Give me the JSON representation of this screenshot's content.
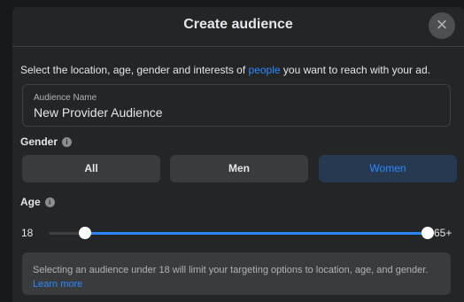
{
  "dialog": {
    "title": "Create audience",
    "close_icon": "close-icon",
    "close_glyph": "×"
  },
  "intro": {
    "text_before": "Select the location, age, gender and interests of ",
    "link": "people",
    "text_after": " you want to reach with your ad."
  },
  "audience_name": {
    "label": "Audience Name",
    "value": "New Provider Audience"
  },
  "gender": {
    "label": "Gender",
    "info_icon": "info-icon",
    "options": [
      "All",
      "Men",
      "Women"
    ],
    "selected": "Women"
  },
  "age": {
    "label": "Age",
    "info_icon": "info-icon",
    "min_label": "18",
    "max_label": "65+",
    "range_min": 13,
    "range_max": 65,
    "selected_min": 18,
    "selected_max": 65
  },
  "notice": {
    "text": "Selecting an audience under 18 will limit your targeting options to location, age, and gender. ",
    "link": "Learn more"
  },
  "colors": {
    "accent": "#2d88ff",
    "background": "#242526",
    "selected_bg": "#263951"
  }
}
